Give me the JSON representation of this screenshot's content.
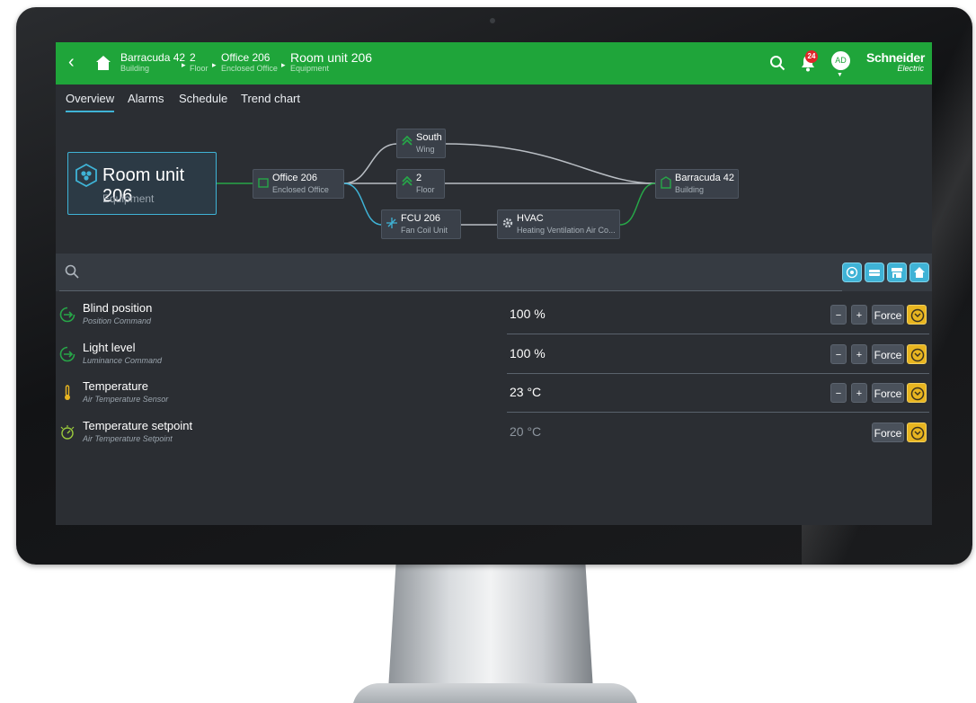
{
  "header": {
    "breadcrumbs": [
      {
        "title": "Barracuda 42",
        "subtitle": "Building"
      },
      {
        "title": "2",
        "subtitle": "Floor"
      },
      {
        "title": "Office 206",
        "subtitle": "Enclosed Office"
      }
    ],
    "current": {
      "title": "Room unit 206",
      "subtitle": "Equipment"
    },
    "notification_count": "24",
    "avatar_initials": "AD",
    "logo_line1": "Schneider",
    "logo_line2": "Electric",
    "colors": {
      "bar": "#1fa53a",
      "accent": "#3fb3d6",
      "override": "#e8b520"
    }
  },
  "tabs": [
    {
      "label": "Overview",
      "active": true
    },
    {
      "label": "Alarms"
    },
    {
      "label": "Schedule"
    },
    {
      "label": "Trend chart"
    }
  ],
  "diagram": {
    "main": {
      "title": "Room unit 206",
      "subtitle": "Equipment",
      "icon": "room-unit-icon"
    },
    "nodes": {
      "office": {
        "title": "Office 206",
        "subtitle": "Enclosed Office",
        "icon": "room-icon"
      },
      "south": {
        "title": "South",
        "subtitle": "Wing",
        "icon": "wing-icon"
      },
      "floor": {
        "title": "2",
        "subtitle": "Floor",
        "icon": "floor-icon"
      },
      "fcu": {
        "title": "FCU 206",
        "subtitle": "Fan Coil Unit",
        "icon": "fan-icon"
      },
      "hvac": {
        "title": "HVAC",
        "subtitle": "Heating Ventilation Air Co...",
        "icon": "gear-icon"
      },
      "building": {
        "title": "Barracuda 42",
        "subtitle": "Building",
        "icon": "building-icon"
      }
    }
  },
  "points": [
    {
      "name": "Blind position",
      "sub": "Position Command",
      "value": "100 %",
      "icon": "command-arrow-icon"
    },
    {
      "name": "Light level",
      "sub": "Luminance Command",
      "value": "100 %",
      "icon": "command-arrow-icon"
    },
    {
      "name": "Temperature",
      "sub": "Air Temperature Sensor",
      "value": "23 °C",
      "icon": "thermometer-icon"
    },
    {
      "name": "Temperature setpoint",
      "sub": "Air Temperature Setpoint",
      "value": "20 °C",
      "icon": "setpoint-icon"
    }
  ],
  "controls": {
    "minus": "−",
    "plus": "+",
    "force": "Force"
  }
}
